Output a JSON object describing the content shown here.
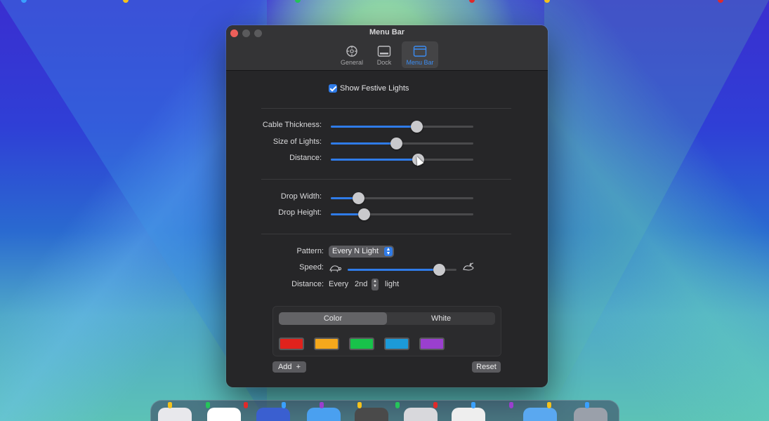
{
  "window": {
    "title": "Menu Bar",
    "tabs": [
      {
        "label": "General",
        "icon": "gear-icon"
      },
      {
        "label": "Dock",
        "icon": "dock-icon"
      },
      {
        "label": "Menu Bar",
        "icon": "menubar-icon",
        "active": true
      }
    ]
  },
  "settings": {
    "show_festive_lights": {
      "label": "Show Festive Lights",
      "checked": true
    },
    "cable_thickness": {
      "label": "Cable Thickness:",
      "value": 0.6
    },
    "size_of_lights": {
      "label": "Size of Lights:",
      "value": 0.46
    },
    "distance_slider": {
      "label": "Distance:",
      "value": 0.61
    },
    "drop_width": {
      "label": "Drop Width:",
      "value": 0.19
    },
    "drop_height": {
      "label": "Drop Height:",
      "value": 0.23
    },
    "pattern": {
      "label": "Pattern:",
      "value": "Every N Light"
    },
    "speed": {
      "label": "Speed:",
      "value": 0.84,
      "slow_icon": "turtle-icon",
      "fast_icon": "hare-icon"
    },
    "distance_step": {
      "label": "Distance:",
      "prefix": "Every",
      "value": "2nd",
      "suffix": "light"
    }
  },
  "colors": {
    "segment": {
      "selected": "Color",
      "other": "White"
    },
    "swatches": [
      "#e0221c",
      "#f5a81c",
      "#18c24a",
      "#1c9ad8",
      "#9a3fce"
    ],
    "add_label": "Add",
    "reset_label": "Reset"
  },
  "accent": "#2f7be8"
}
